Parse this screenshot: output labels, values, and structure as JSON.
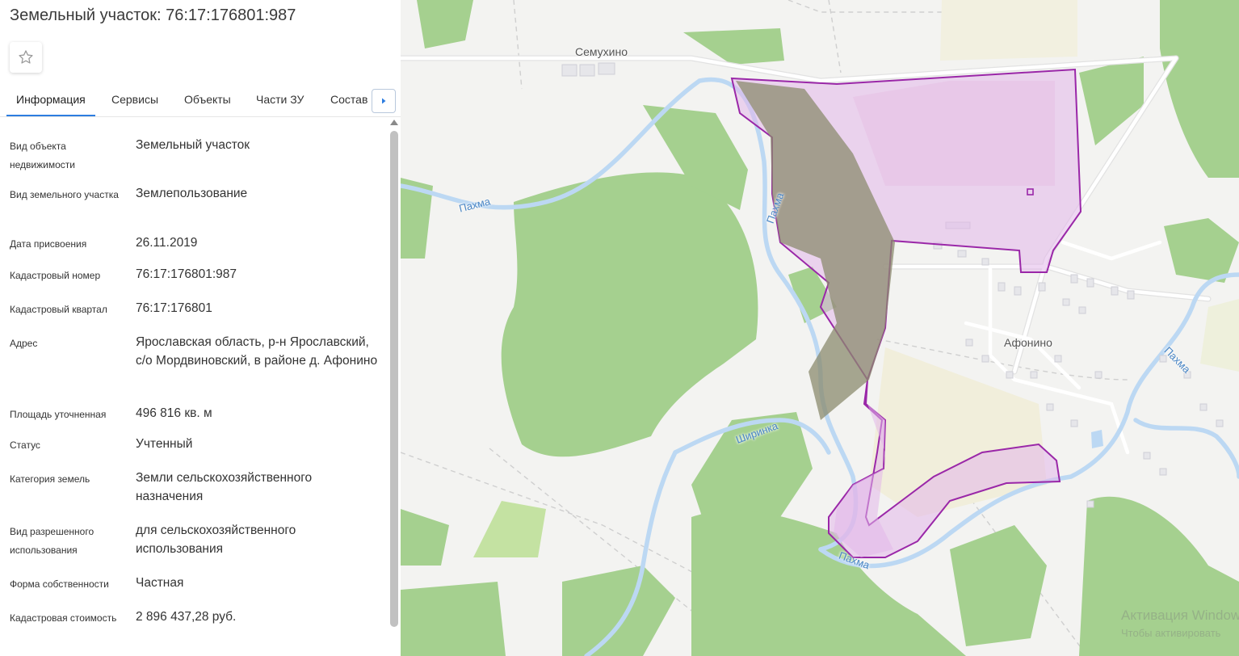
{
  "panel": {
    "title": "Земельный участок: 76:17:176801:987",
    "tabs": [
      "Информация",
      "Сервисы",
      "Объекты",
      "Части ЗУ",
      "Состав"
    ],
    "rows": [
      {
        "label": "Вид объекта недвижимости",
        "value": "Земельный участок"
      },
      {
        "label": "Вид земельного участка",
        "value": "Землепользование"
      },
      {
        "label": "Дата присвоения",
        "value": "26.11.2019"
      },
      {
        "label": "Кадастровый номер",
        "value": "76:17:176801:987"
      },
      {
        "label": "Кадастровый квартал",
        "value": "76:17:176801"
      },
      {
        "label": "Адрес",
        "value": "Ярославская область, р-н Ярославский, с/о Мордвиновский, в районе д. Афонино"
      },
      {
        "label": "Площадь уточненная",
        "value": "496 816 кв. м"
      },
      {
        "label": "Статус",
        "value": "Учтенный"
      },
      {
        "label": "Категория земель",
        "value": "Земли сельскохозяйственного назначения"
      },
      {
        "label": "Вид разрешенного использования",
        "value": "для сельскохозяйственного использования"
      },
      {
        "label": "Форма собственности",
        "value": "Частная"
      },
      {
        "label": "Кадастровая стоимость",
        "value": "2 896 437,28 руб."
      }
    ]
  },
  "map": {
    "places": [
      "Семухино",
      "Афонино"
    ],
    "rivers": [
      "Пахма",
      "Пахма",
      "Ширинка",
      "Пахма",
      "Пахма"
    ],
    "watermark": "Активация Windows",
    "watermark_sub": "Чтобы активировать"
  },
  "colors": {
    "accent": "#2d7de0",
    "forest": "#a5d08f",
    "water": "#bcd8f3",
    "parcel_border": "#9a27a8",
    "parcel_fill": "#e2b6ea"
  }
}
